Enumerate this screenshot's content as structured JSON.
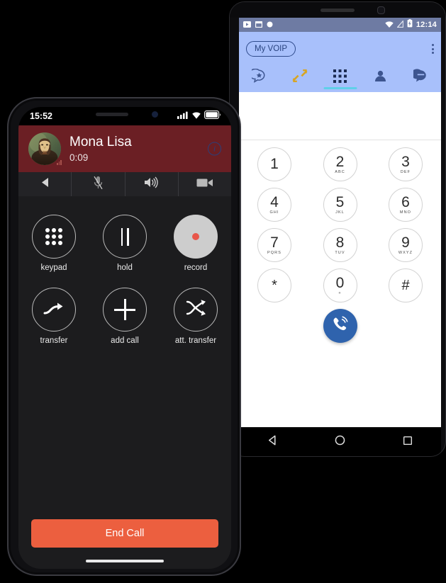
{
  "android": {
    "statusbar": {
      "time": "12:14",
      "left_icons": [
        "video-icon",
        "window-icon",
        "dot-icon"
      ],
      "right_icons": [
        "wifi-icon",
        "signal-off-icon",
        "battery-charging-icon"
      ]
    },
    "appbar": {
      "account_label": "My VOIP",
      "overflow_menu": "overflow-menu"
    },
    "tabs": [
      {
        "name": "favorites",
        "icon": "speech-bubble-star-icon",
        "active": false
      },
      {
        "name": "history",
        "icon": "call-history-arrows-icon",
        "active": false
      },
      {
        "name": "dialpad",
        "icon": "dialpad-grid-icon",
        "active": true
      },
      {
        "name": "contacts",
        "icon": "person-icon",
        "active": false
      },
      {
        "name": "messages",
        "icon": "chat-bubble-icon",
        "active": false
      }
    ],
    "number_field": {
      "value": "",
      "placeholder": ""
    },
    "dialpad": [
      [
        {
          "digit": "1",
          "letters": ""
        },
        {
          "digit": "2",
          "letters": "ABC"
        },
        {
          "digit": "3",
          "letters": "DEF"
        }
      ],
      [
        {
          "digit": "4",
          "letters": "GHI"
        },
        {
          "digit": "5",
          "letters": "JKL"
        },
        {
          "digit": "6",
          "letters": "MNO"
        }
      ],
      [
        {
          "digit": "7",
          "letters": "PQRS"
        },
        {
          "digit": "8",
          "letters": "TUV"
        },
        {
          "digit": "9",
          "letters": "WXYZ"
        }
      ],
      [
        {
          "digit": "*",
          "letters": ""
        },
        {
          "digit": "0",
          "letters": "+"
        },
        {
          "digit": "#",
          "letters": ""
        }
      ]
    ],
    "call_button": "call-icon",
    "navbar": [
      "back-icon",
      "home-icon",
      "recents-icon"
    ],
    "colors": {
      "appbar": "#a8c0fb",
      "statusbar": "#6e7ba3",
      "tab_indicator": "#5fd0e8",
      "call_fab": "#2f63ad",
      "history_icon": "#d8a522"
    }
  },
  "iphone": {
    "statusbar": {
      "time": "15:52",
      "right_icons": [
        "cellular-signal-icon",
        "wifi-icon",
        "battery-icon"
      ]
    },
    "call": {
      "caller_name": "Mona Lisa",
      "duration": "0:09",
      "info_button": "i",
      "avatar": "mona-lisa-avatar"
    },
    "toolbar": [
      {
        "name": "back",
        "icon": "back-triangle-icon"
      },
      {
        "name": "mute",
        "icon": "microphone-muted-icon"
      },
      {
        "name": "speaker",
        "icon": "speaker-icon"
      },
      {
        "name": "video",
        "icon": "video-camera-icon"
      }
    ],
    "actions": [
      [
        {
          "label": "keypad",
          "icon": "keypad-dots-icon",
          "filled": false
        },
        {
          "label": "hold",
          "icon": "pause-bars-icon",
          "filled": false
        },
        {
          "label": "record",
          "icon": "record-dot-icon",
          "filled": true
        }
      ],
      [
        {
          "label": "transfer",
          "icon": "transfer-arrow-icon",
          "filled": false
        },
        {
          "label": "add call",
          "icon": "plus-icon",
          "filled": false
        },
        {
          "label": "att. transfer",
          "icon": "attended-transfer-icon",
          "filled": false
        }
      ]
    ],
    "end_call_label": "End Call",
    "colors": {
      "header": "#6b1f24",
      "toolbar": "#232326",
      "end_call": "#ec5f3f",
      "record_dot": "#e8564a",
      "info": "#2b3f7a"
    }
  }
}
